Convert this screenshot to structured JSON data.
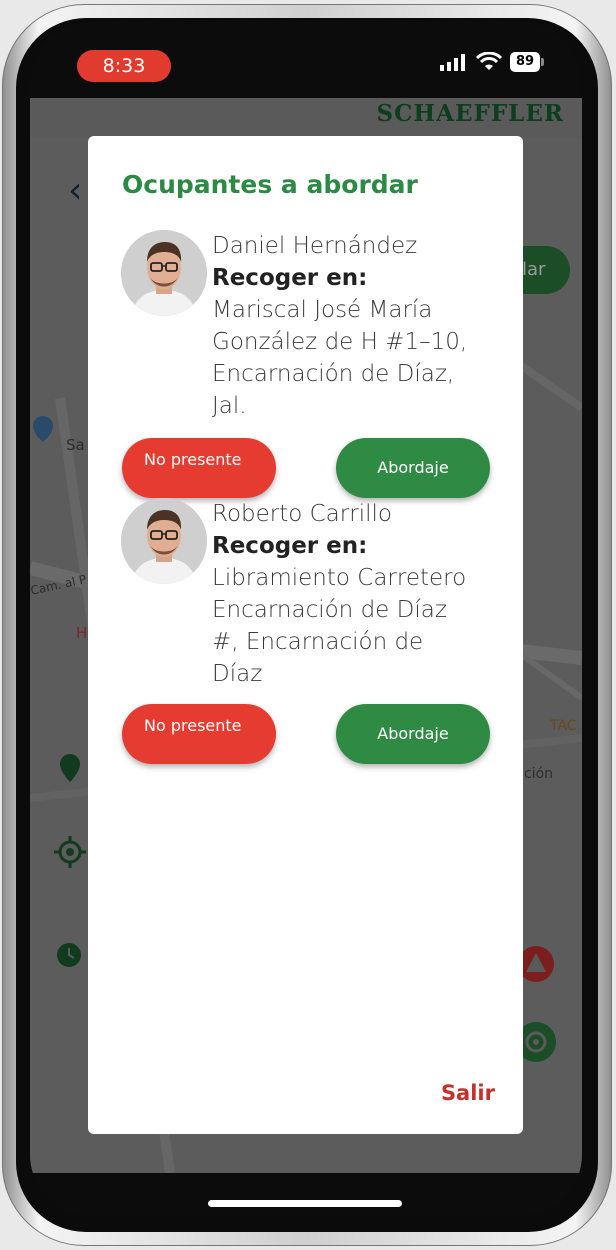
{
  "status_bar": {
    "time": "8:33",
    "battery": "89"
  },
  "background": {
    "brand": "SCHAEFFLER",
    "map_labels": {
      "label_sa": "Sa",
      "label_cam": "Cam. al P",
      "label_h": "H",
      "label_tac": "TAC",
      "label_cion": "ción"
    },
    "action_button_fragment": "lar"
  },
  "dialog": {
    "title": "Ocupantes a abordar",
    "passengers": [
      {
        "name": "Daniel Hernández",
        "pickup_label": "Recoger en:",
        "address": "Mariscal José María González de H #1–10, Encarnación de Díaz, Jal.",
        "not_present_label": "No presente",
        "board_label": "Abordaje"
      },
      {
        "name": "Roberto Carrillo",
        "pickup_label": "Recoger en:",
        "address": "Libramiento Carretero Encarnación de Díaz #, Encarnación de Díaz",
        "not_present_label": "No presente",
        "board_label": "Abordaje"
      }
    ],
    "exit_label": "Salir"
  },
  "colors": {
    "title_green": "#2c8a45",
    "board_green": "#2f8a43",
    "absent_red": "#e63b30",
    "exit_red": "#c4312a",
    "time_pill_red": "#e13a2e"
  }
}
